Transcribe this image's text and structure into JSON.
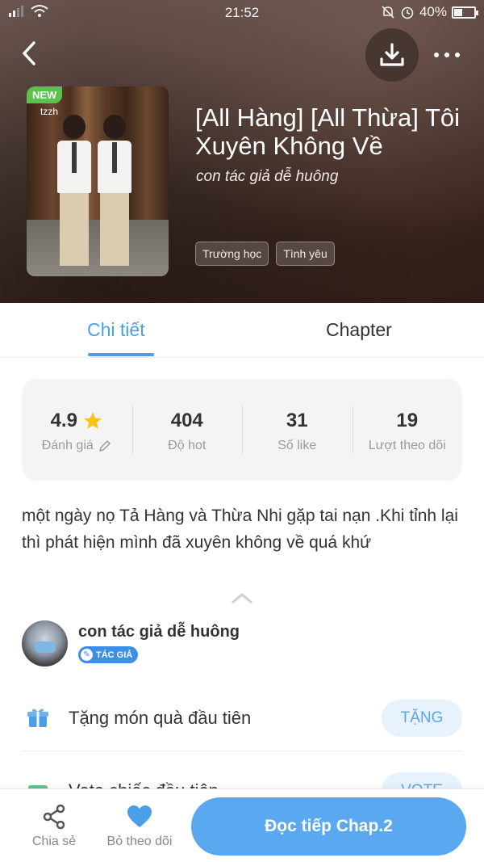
{
  "status_bar": {
    "time": "21:52",
    "battery": "40%",
    "battery_level": 0.4
  },
  "book": {
    "badge": "NEW",
    "cover_mark": "tzzh",
    "title": "[All Hàng] [All Thừa] Tôi Xuyên Không Về",
    "author": "con tác giả dễ huông",
    "tags": [
      "Trường học",
      "Tình yêu"
    ]
  },
  "tabs": {
    "detail": "Chi tiết",
    "chapter": "Chapter",
    "active": "detail"
  },
  "stats": [
    {
      "value": "4.9",
      "label": "Đánh giá"
    },
    {
      "value": "404",
      "label": "Độ hot"
    },
    {
      "value": "31",
      "label": "Số like"
    },
    {
      "value": "19",
      "label": "Lượt theo dõi"
    }
  ],
  "description": "một ngày nọ Tả Hàng và Thừa Nhi gặp tai nạn .Khi tỉnh lại thì phát hiện mình đã xuyên không về quá khứ",
  "author_card": {
    "name": "con tác giả dễ huông",
    "badge": "TÁC GIẢ"
  },
  "actions": [
    {
      "label": "Tặng món quà đầu tiên",
      "button": "TẶNG"
    },
    {
      "label": "Vote chiếc đầu tiên",
      "button": "VOTE"
    }
  ],
  "bottom_bar": {
    "share": "Chia sẻ",
    "follow": "Bỏ theo dõi",
    "read": "Đọc tiếp Chap.2"
  },
  "colors": {
    "accent": "#4a9fe8",
    "read_button": "#5aa8f0",
    "new_badge": "#59c24a",
    "star": "#f5c518"
  }
}
